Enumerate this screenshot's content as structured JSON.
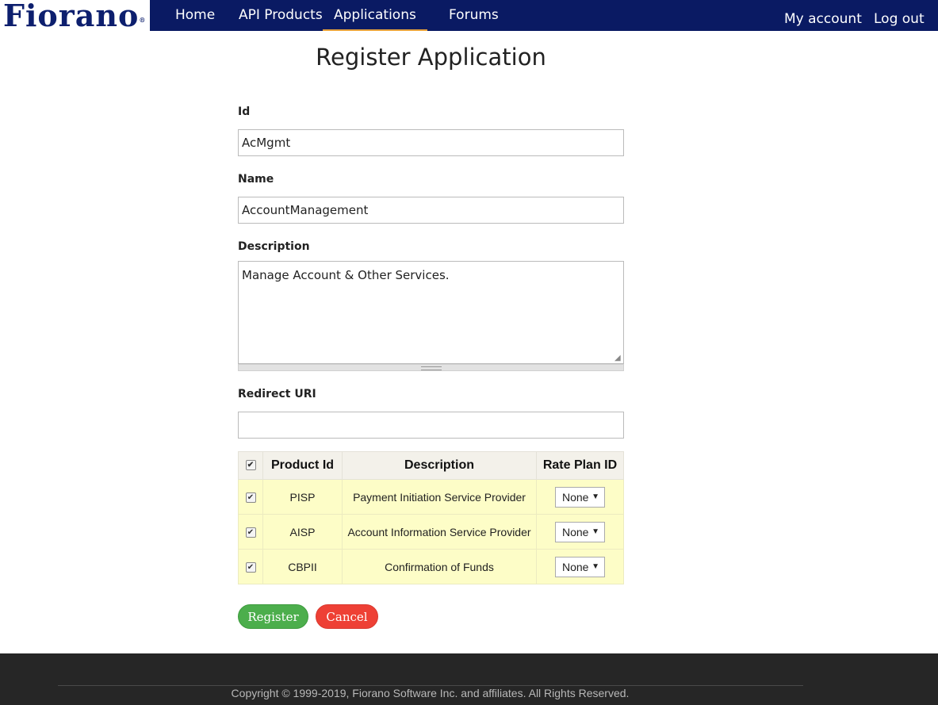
{
  "brand": {
    "logo_text": "Fiorano",
    "logo_mark": "®",
    "color": "#0d1f6e"
  },
  "nav": {
    "items": [
      {
        "label": "Home"
      },
      {
        "label": "API Products"
      },
      {
        "label": "Applications",
        "active": true
      },
      {
        "label": "Forums"
      }
    ],
    "right": [
      {
        "label": "My account"
      },
      {
        "label": "Log out"
      }
    ],
    "bg_color": "#0a1a63",
    "active_underline_color": "#e8a33c"
  },
  "page": {
    "title": "Register Application"
  },
  "form": {
    "id": {
      "label": "Id",
      "value": "AcMgmt"
    },
    "name": {
      "label": "Name",
      "value": "AccountManagement"
    },
    "description": {
      "label": "Description",
      "value": "Manage Account & Other Services."
    },
    "redirect_uri": {
      "label": "Redirect URI",
      "value": ""
    }
  },
  "products_table": {
    "headers": {
      "select_all_checked": true,
      "product_id": "Product Id",
      "description": "Description",
      "rate_plan": "Rate Plan ID"
    },
    "rows": [
      {
        "checked": true,
        "product_id": "PISP",
        "description": "Payment Initiation Service Provider",
        "rate_plan": "None"
      },
      {
        "checked": true,
        "product_id": "AISP",
        "description": "Account Information Service Provider",
        "rate_plan": "None"
      },
      {
        "checked": true,
        "product_id": "CBPII",
        "description": "Confirmation of Funds",
        "rate_plan": "None"
      }
    ]
  },
  "buttons": {
    "register": {
      "label": "Register",
      "color": "#4cae4c"
    },
    "cancel": {
      "label": "Cancel",
      "color": "#ee4035"
    }
  },
  "footer": {
    "copyright": "Copyright © 1999-2019, Fiorano Software Inc. and affiliates. All Rights Reserved."
  }
}
